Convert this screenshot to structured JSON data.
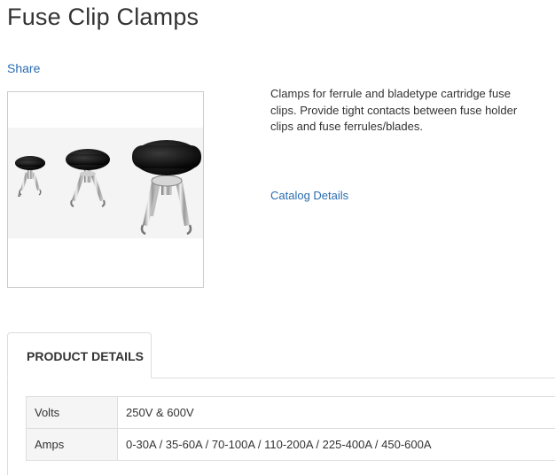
{
  "page": {
    "title": "Fuse Clip Clamps",
    "share_label": "Share"
  },
  "product": {
    "description": "Clamps for ferrule and bladetype cartridge fuse clips. Provide tight contacts between fuse holder clips and fuse ferrules/blades.",
    "catalog_link": "Catalog Details"
  },
  "tabs": [
    {
      "label": "PRODUCT DETAILS",
      "active": true
    }
  ],
  "specs": [
    {
      "key": "Volts",
      "value": "250V & 600V"
    },
    {
      "key": "Amps",
      "value": "0-30A / 35-60A / 70-100A / 110-200A / 225-400A / 450-600A"
    }
  ]
}
